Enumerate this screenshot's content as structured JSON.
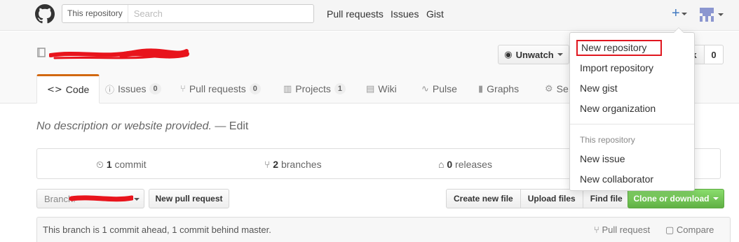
{
  "search": {
    "scope": "This repository",
    "placeholder": "Search"
  },
  "nav": {
    "pull_requests": "Pull requests",
    "issues": "Issues",
    "gist": "Gist"
  },
  "header_icons": {
    "plus": "plus-icon",
    "avatar": "avatar-icon"
  },
  "repo": {
    "icon": "repo-book-icon",
    "title_redacted": true
  },
  "actions": {
    "unwatch": "Unwatch",
    "star_count": "0"
  },
  "tabs": [
    {
      "label": "Code",
      "icon": "code-icon"
    },
    {
      "label": "Issues",
      "count": "0",
      "icon": "issue-icon"
    },
    {
      "label": "Pull requests",
      "count": "0",
      "icon": "pull-request-icon"
    },
    {
      "label": "Projects",
      "count": "1",
      "icon": "project-icon"
    },
    {
      "label": "Wiki",
      "icon": "wiki-icon"
    },
    {
      "label": "Pulse",
      "icon": "pulse-icon"
    },
    {
      "label": "Graphs",
      "icon": "graph-icon"
    },
    {
      "label": "Se",
      "icon": "gear-icon"
    }
  ],
  "description": {
    "text": "No description or website provided.",
    "sep": " — ",
    "edit": "Edit"
  },
  "summary": {
    "commits": {
      "num": "1",
      "label": "commit"
    },
    "branches": {
      "num": "2",
      "label": "branches"
    },
    "releases": {
      "num": "0",
      "label": "releases"
    }
  },
  "branch": {
    "label": "Branch:"
  },
  "buttons": {
    "new_pr": "New pull request",
    "create": "Create new file",
    "upload": "Upload files",
    "find": "Find file",
    "clone": "Clone or download"
  },
  "ahead": {
    "message": "This branch is 1 commit ahead, 1 commit behind master.",
    "pull_request": "Pull request",
    "compare": "Compare"
  },
  "dropdown": {
    "items": [
      "New repository",
      "Import repository",
      "New gist",
      "New organization"
    ],
    "section": "This repository",
    "section_items": [
      "New issue",
      "New collaborator"
    ]
  },
  "colors": {
    "accent": "#4078c0",
    "tab_active": "#d26911",
    "highlight": "#e0161f",
    "clone": "#6cc644"
  }
}
